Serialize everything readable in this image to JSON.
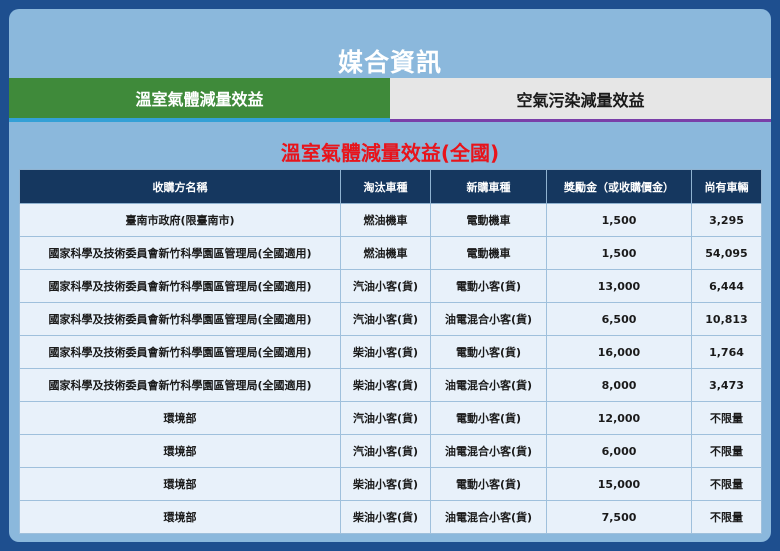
{
  "panel_title": "媒合資訊",
  "tabs": [
    {
      "label": "溫室氣體減量效益"
    },
    {
      "label": "空氣污染減量效益"
    }
  ],
  "colors": {
    "page_background": "#1e4f8f",
    "panel_background": "#8bb8dc",
    "active_tab": "#3f8a3a",
    "inactive_tab": "#e6e6e6",
    "section_title": "#e8141b",
    "table_header": "#15375f",
    "table_cell": "#e8f1fa"
  },
  "section_title": "溫室氣體減量效益(全國)",
  "table": {
    "headers": [
      "收購方名稱",
      "淘汰車種",
      "新購車種",
      "獎勵金（或收購價金）",
      "尚有車輛"
    ],
    "rows": [
      [
        "臺南市政府(限臺南市)",
        "燃油機車",
        "電動機車",
        "1,500",
        "3,295"
      ],
      [
        "國家科學及技術委員會新竹科學園區管理局(全國適用)",
        "燃油機車",
        "電動機車",
        "1,500",
        "54,095"
      ],
      [
        "國家科學及技術委員會新竹科學園區管理局(全國適用)",
        "汽油小客(貨)",
        "電動小客(貨)",
        "13,000",
        "6,444"
      ],
      [
        "國家科學及技術委員會新竹科學園區管理局(全國適用)",
        "汽油小客(貨)",
        "油電混合小客(貨)",
        "6,500",
        "10,813"
      ],
      [
        "國家科學及技術委員會新竹科學園區管理局(全國適用)",
        "柴油小客(貨)",
        "電動小客(貨)",
        "16,000",
        "1,764"
      ],
      [
        "國家科學及技術委員會新竹科學園區管理局(全國適用)",
        "柴油小客(貨)",
        "油電混合小客(貨)",
        "8,000",
        "3,473"
      ],
      [
        "環境部",
        "汽油小客(貨)",
        "電動小客(貨)",
        "12,000",
        "不限量"
      ],
      [
        "環境部",
        "汽油小客(貨)",
        "油電混合小客(貨)",
        "6,000",
        "不限量"
      ],
      [
        "環境部",
        "柴油小客(貨)",
        "電動小客(貨)",
        "15,000",
        "不限量"
      ],
      [
        "環境部",
        "柴油小客(貨)",
        "油電混合小客(貨)",
        "7,500",
        "不限量"
      ]
    ]
  }
}
